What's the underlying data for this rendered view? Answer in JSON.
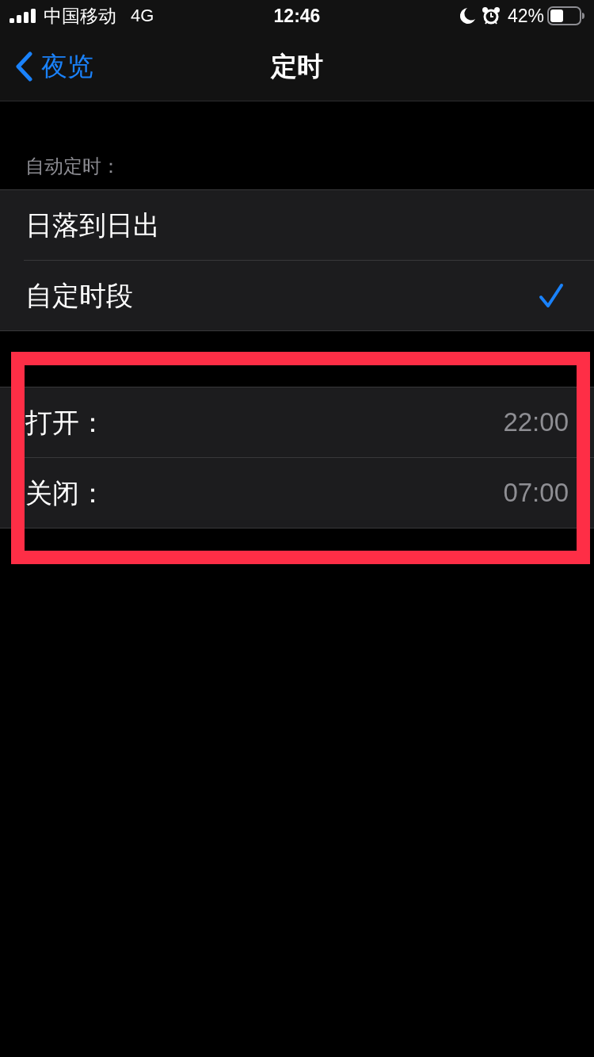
{
  "status_bar": {
    "carrier": "中国移动",
    "network": "4G",
    "time": "12:46",
    "battery_percent": "42%"
  },
  "nav_bar": {
    "back_label": "夜览",
    "title": "定时"
  },
  "auto_schedule": {
    "header": "自动定时：",
    "options": [
      {
        "label": "日落到日出",
        "selected": false
      },
      {
        "label": "自定时段",
        "selected": true
      }
    ]
  },
  "custom_times": {
    "highlighted": true,
    "rows": [
      {
        "label": "打开：",
        "value": "22:00"
      },
      {
        "label": "关闭：",
        "value": "07:00"
      }
    ]
  }
}
